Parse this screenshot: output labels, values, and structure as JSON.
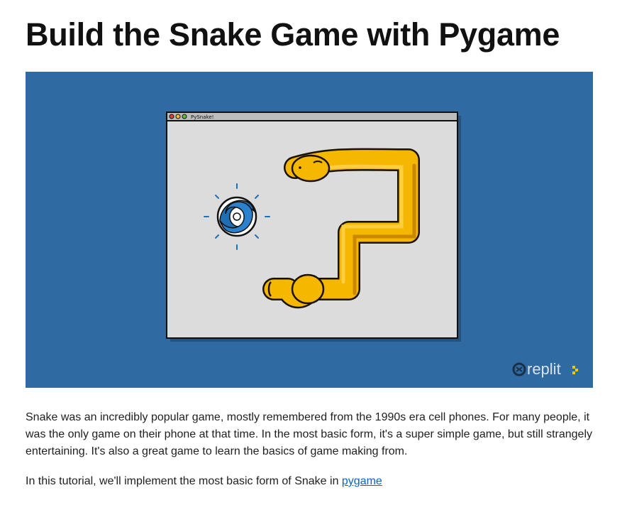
{
  "article": {
    "title": "Build the Snake Game with Pygame",
    "paragraphs": {
      "intro": "Snake was an incredibly popular game, mostly remembered from the 1990s era cell phones. For many people, it was the only game on their phone at that time. In the most basic form, it's a super simple game, but still strangely entertaining. It's also a great game to learn the basics of game making from.",
      "tutorial_prefix": "In this tutorial, we'll implement the most basic form of Snake in ",
      "tutorial_link": "pygame"
    }
  },
  "hero_image": {
    "window_title": "PySnake!",
    "brand_text": "replit",
    "colors": {
      "background": "#2f6aa3",
      "window_body": "#dcdcdc",
      "title_bar": "#bdbdbd",
      "snake": "#f6b700",
      "snake_dark": "#d08a00",
      "portal": "#1f6fb5",
      "brand_text": "#d9e3ee",
      "brand_accent": "#f5c400"
    },
    "icons": {
      "window_buttons": [
        "close-dot",
        "minimize-dot",
        "maximize-dot"
      ],
      "food": "vortex-icon",
      "brand": "replit-logo-icon"
    }
  }
}
